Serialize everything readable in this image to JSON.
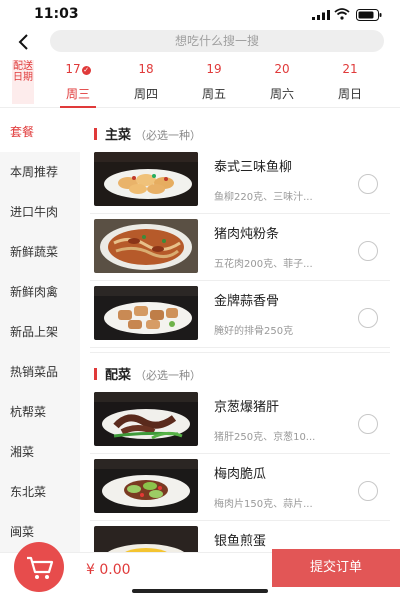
{
  "status": {
    "time": "11:03"
  },
  "search": {
    "placeholder": "想吃什么搜一搜"
  },
  "dates": {
    "label": "配送日期",
    "items": [
      {
        "num": "17",
        "day": "周三",
        "active": true,
        "checked": true
      },
      {
        "num": "18",
        "day": "周四",
        "active": false
      },
      {
        "num": "19",
        "day": "周五",
        "active": false
      },
      {
        "num": "20",
        "day": "周六",
        "active": false
      },
      {
        "num": "21",
        "day": "周日",
        "active": false
      }
    ]
  },
  "categories": [
    {
      "label": "套餐",
      "active": true
    },
    {
      "label": "本周推荐"
    },
    {
      "label": "进口牛肉"
    },
    {
      "label": "新鲜蔬菜"
    },
    {
      "label": "新鲜肉禽"
    },
    {
      "label": "新品上架"
    },
    {
      "label": "热销菜品"
    },
    {
      "label": "杭帮菜"
    },
    {
      "label": "湘菜"
    },
    {
      "label": "东北菜"
    },
    {
      "label": "闽菜"
    }
  ],
  "sections": [
    {
      "title": "主菜",
      "note": "（必选一种）",
      "dishes": [
        {
          "name": "泰式三味鱼柳",
          "desc": "鱼柳220克、三味汁..."
        },
        {
          "name": "猪肉炖粉条",
          "desc": "五花肉200克、菲子..."
        },
        {
          "name": "金牌蒜香骨",
          "desc": "腌好的排骨250克"
        }
      ]
    },
    {
      "title": "配菜",
      "note": "（必选一种）",
      "dishes": [
        {
          "name": "京葱爆猪肝",
          "desc": "猪肝250克、京葱10..."
        },
        {
          "name": "梅肉脆瓜",
          "desc": "梅肉片150克、蒜片..."
        },
        {
          "name": "银鱼煎蛋",
          "desc": ""
        }
      ]
    }
  ],
  "cart": {
    "total": "¥ 0.00"
  },
  "submit": {
    "label": "提交订单"
  },
  "colors": {
    "accent": "#e03a3a",
    "cart": "#e74c4c",
    "submit": "#e25656"
  }
}
